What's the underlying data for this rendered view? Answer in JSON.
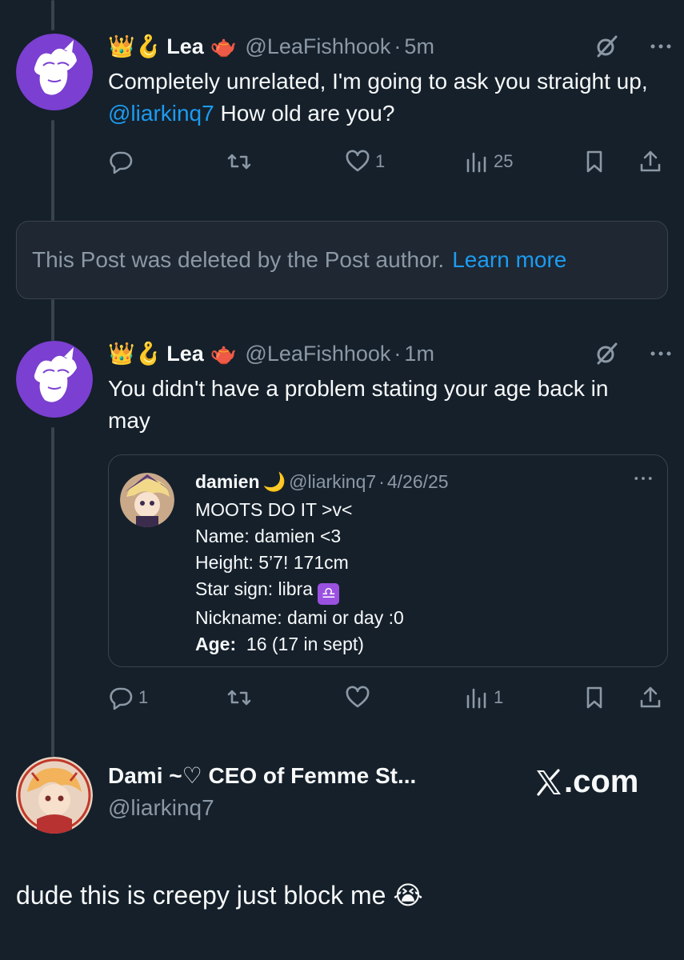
{
  "posts": [
    {
      "badges": "👑🪝",
      "name": "Lea",
      "name_emoji": "🫖",
      "handle": "@LeaFishhook",
      "dot": "·",
      "time": "5m",
      "text_before": "Completely unrelated, I'm going to ask you straight up, ",
      "mention": "@liarkinq7",
      "text_after": " How old are you?",
      "replies": "",
      "reposts": "",
      "likes": "1",
      "views": "25"
    },
    {
      "badges": "👑🪝",
      "name": "Lea",
      "name_emoji": "🫖",
      "handle": "@LeaFishhook",
      "dot": "·",
      "time": "1m",
      "text": "You didn't have a problem stating your age back in may",
      "replies": "1",
      "reposts": "",
      "likes": "",
      "views": "1"
    }
  ],
  "deleted_notice": {
    "text": "This Post was deleted by the Post author.",
    "link": "Learn more"
  },
  "quoted_post": {
    "name": "damien",
    "name_emoji": "🌙",
    "handle": "@liarkinq7",
    "dot": "·",
    "date": "4/26/25",
    "lines": [
      "MOOTS DO IT >v<",
      "Name: damien <3",
      "Height: 5’7! 171cm",
      "Star sign: libra"
    ],
    "libra_symbol": "♎",
    "line_nickname": "Nickname: dami or day :0",
    "age_label": "Age:",
    "age_value": "  16 (17 in sept)"
  },
  "reply": {
    "name": "Dami ~♡ CEO of Femme St...",
    "handle": "@liarkinq7",
    "body": "dude this is creepy just block me 😭"
  },
  "watermark": ".com",
  "colors": {
    "background": "#15202b",
    "accent": "#1d9bf0",
    "secondary_text": "#8b98a5",
    "border": "#38444d",
    "avatar_purple": "#7b3fd1"
  }
}
